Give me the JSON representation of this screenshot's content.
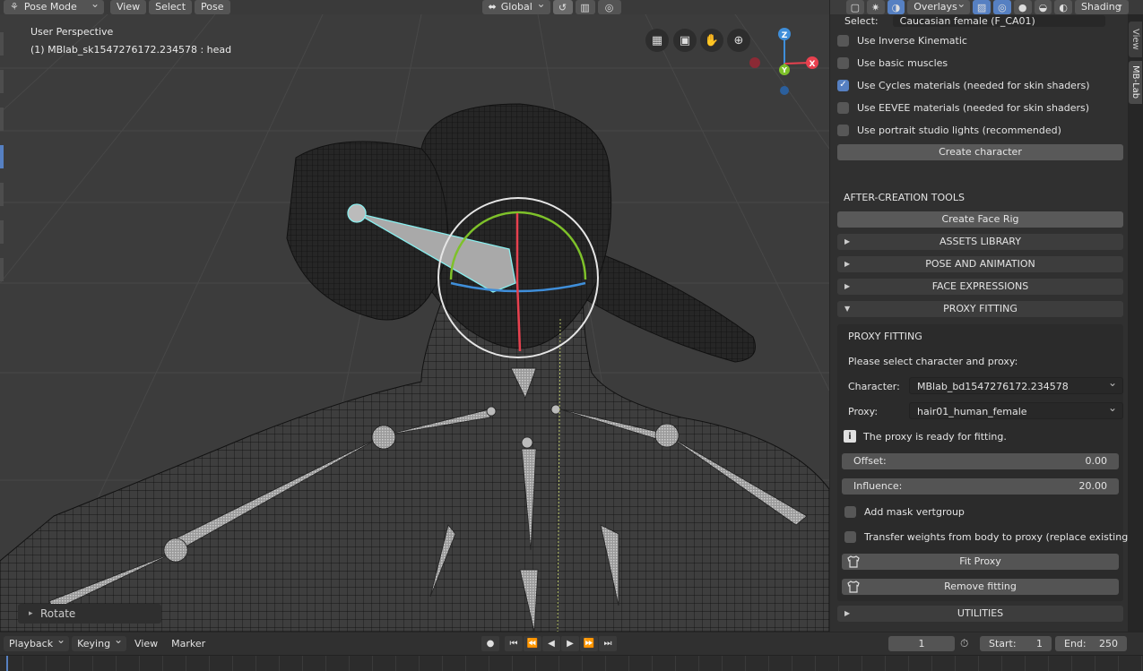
{
  "header": {
    "mode": "Pose Mode",
    "menus": [
      "View",
      "Select",
      "Pose"
    ],
    "transform_orientation": "Global",
    "overlays": "Overlays",
    "shading": "Shading"
  },
  "viewport": {
    "perspective_label": "User Perspective",
    "object_label": "(1) MBlab_sk1547276172.234578 : head",
    "gizmo_axes": {
      "z": "Z",
      "y": "Y",
      "x": "X"
    },
    "last_operator": "Rotate"
  },
  "sidebar": {
    "select_row": {
      "label": "Select:",
      "value": "Caucasian female (F_CA01)"
    },
    "options": [
      {
        "label": "Use Inverse Kinematic",
        "checked": false
      },
      {
        "label": "Use basic muscles",
        "checked": false
      },
      {
        "label": "Use Cycles materials (needed for skin shaders)",
        "checked": true
      },
      {
        "label": "Use EEVEE materials (needed for skin shaders)",
        "checked": false
      },
      {
        "label": "Use portrait studio lights (recommended)",
        "checked": false
      }
    ],
    "create_character": "Create character",
    "after_creation_title": "AFTER-CREATION TOOLS",
    "create_face_rig": "Create Face Rig",
    "panels": {
      "assets": "ASSETS LIBRARY",
      "pose": "POSE AND ANIMATION",
      "face": "FACE EXPRESSIONS",
      "proxy": "PROXY FITTING",
      "utilities": "UTILITIES"
    },
    "proxy_fitting": {
      "title": "PROXY FITTING",
      "instruction": "Please select character and proxy:",
      "character_label": "Character:",
      "character_value": "MBlab_bd1547276172.234578",
      "proxy_label": "Proxy:",
      "proxy_value": "hair01_human_female",
      "status": "The proxy is ready for fitting.",
      "offset_label": "Offset:",
      "offset_value": "0.00",
      "influence_label": "Influence:",
      "influence_value": "20.00",
      "add_mask": "Add mask vertgroup",
      "transfer_weights": "Transfer weights from body to proxy (replace existing)",
      "fit_proxy": "Fit Proxy",
      "remove_fitting": "Remove fitting"
    },
    "tabs": [
      "View",
      "MB-Lab"
    ]
  },
  "timeline": {
    "menus": [
      "Playback",
      "Keying",
      "View",
      "Marker"
    ],
    "current_frame": "1",
    "start_label": "Start:",
    "start_value": "1",
    "end_label": "End:",
    "end_value": "250"
  },
  "colors": {
    "accent": "#5680c2",
    "axis_x": "#e8414f",
    "axis_y": "#7ec12a",
    "axis_z": "#3f8ed9",
    "background": "#3c3c3c"
  }
}
